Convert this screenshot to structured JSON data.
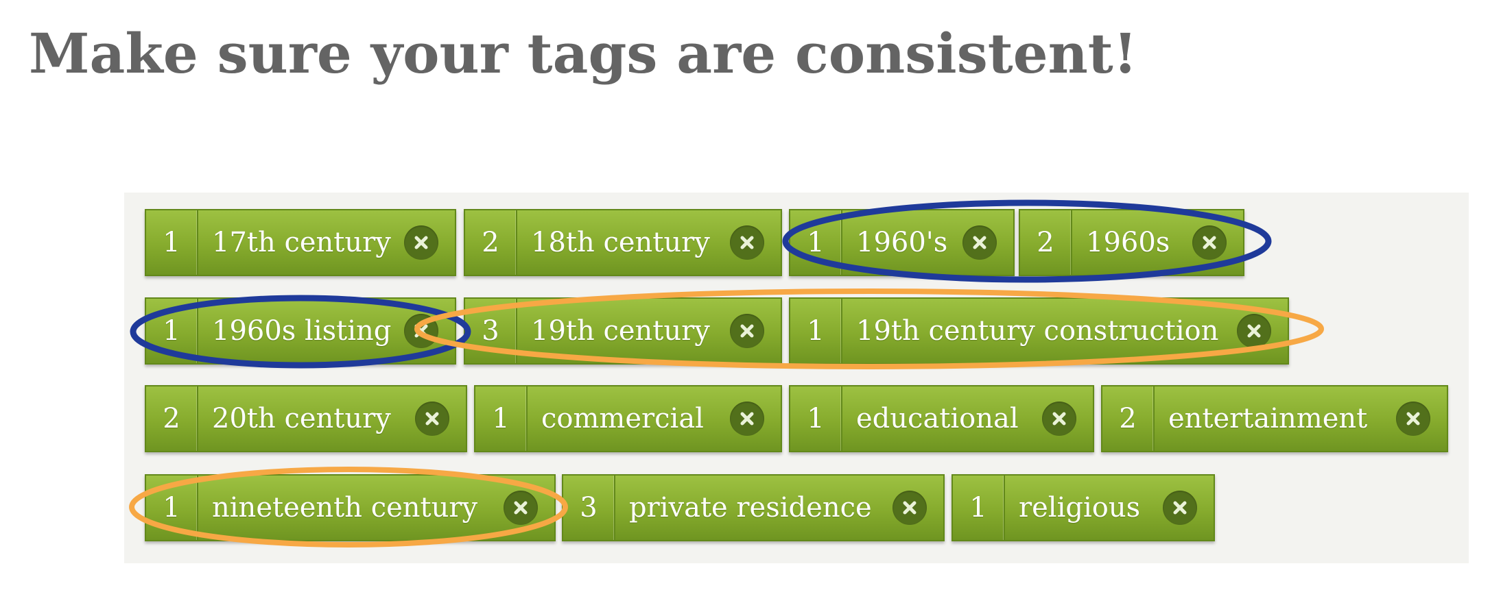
{
  "heading": "Make sure your tags are consistent!",
  "colors": {
    "tag_green": "#86ab2d",
    "remove_circle": "#52701b",
    "highlight_blue": "#1f3a9a",
    "highlight_orange": "#f7a845"
  },
  "remove_icon": "close-x-icon",
  "tags": [
    {
      "count": "1",
      "label": "17th century"
    },
    {
      "count": "2",
      "label": "18th century"
    },
    {
      "count": "1",
      "label": "1960's"
    },
    {
      "count": "2",
      "label": "1960s"
    },
    {
      "count": "1",
      "label": "1960s listing"
    },
    {
      "count": "3",
      "label": "19th century"
    },
    {
      "count": "1",
      "label": "19th century construction"
    },
    {
      "count": "2",
      "label": "20th century"
    },
    {
      "count": "1",
      "label": "commercial"
    },
    {
      "count": "1",
      "label": "educational"
    },
    {
      "count": "2",
      "label": "entertainment"
    },
    {
      "count": "1",
      "label": "nineteenth century"
    },
    {
      "count": "3",
      "label": "private residence"
    },
    {
      "count": "1",
      "label": "religious"
    }
  ]
}
